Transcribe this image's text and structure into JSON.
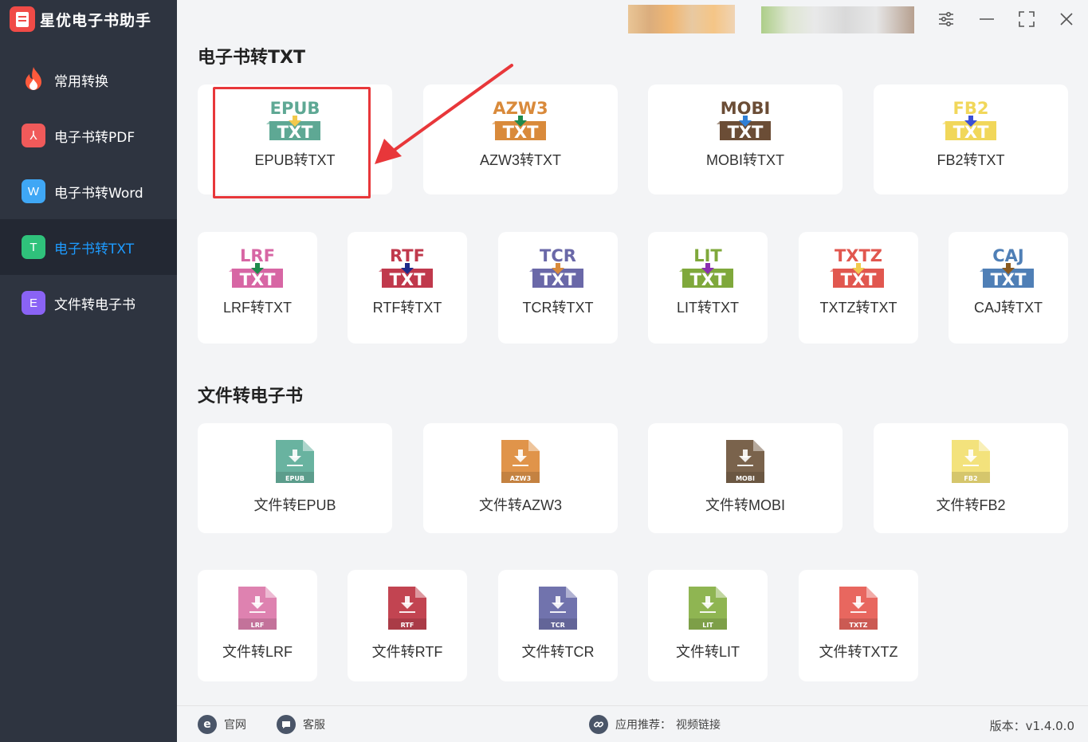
{
  "app": {
    "name": "星优电子书助手"
  },
  "sidebar": {
    "items": [
      {
        "label": "常用转换",
        "icon": "flame-icon",
        "color": "#ff5a3c",
        "glyph": ""
      },
      {
        "label": "电子书转PDF",
        "icon": "pdf-icon",
        "color": "#f05a5a",
        "glyph": "⅄"
      },
      {
        "label": "电子书转Word",
        "icon": "word-icon",
        "color": "#3fa7f5",
        "glyph": "W"
      },
      {
        "label": "电子书转TXT",
        "icon": "txt-icon",
        "color": "#2fc27b",
        "glyph": "T",
        "active": true
      },
      {
        "label": "文件转电子书",
        "icon": "ebook-icon",
        "color": "#8a63f5",
        "glyph": "E"
      }
    ]
  },
  "sections": [
    {
      "title": "电子书转TXT"
    },
    {
      "title": "文件转电子书"
    }
  ],
  "to_txt": [
    {
      "fmt": "EPUB",
      "label": "EPUB转TXT",
      "color": "#5ea894",
      "arrow": "#f2c94c",
      "highlighted": true
    },
    {
      "fmt": "AZW3",
      "label": "AZW3转TXT",
      "color": "#d98a3b",
      "arrow": "#1f8a4c"
    },
    {
      "fmt": "MOBI",
      "label": "MOBI转TXT",
      "color": "#6b4d36",
      "arrow": "#2f7fd6"
    },
    {
      "fmt": "FB2",
      "label": "FB2转TXT",
      "color": "#f1d75a",
      "arrow": "#3b4fd6"
    },
    {
      "fmt": "LRF",
      "label": "LRF转TXT",
      "color": "#d766a4",
      "arrow": "#1f8a4c"
    },
    {
      "fmt": "RTF",
      "label": "RTF转TXT",
      "color": "#c0394c",
      "arrow": "#1d2a8a"
    },
    {
      "fmt": "TCR",
      "label": "TCR转TXT",
      "color": "#6a68a8",
      "arrow": "#d98a3b"
    },
    {
      "fmt": "LIT",
      "label": "LIT转TXT",
      "color": "#7fa83b",
      "arrow": "#8a2fb0"
    },
    {
      "fmt": "TXTZ",
      "label": "TXTZ转TXT",
      "color": "#e1574f",
      "arrow": "#f2c94c"
    },
    {
      "fmt": "CAJ",
      "label": "CAJ转TXT",
      "color": "#4f7fb6",
      "arrow": "#8a5a1f"
    }
  ],
  "to_ebook": [
    {
      "fmt": "EPUB",
      "label": "文件转EPUB",
      "color": "#69b3a0"
    },
    {
      "fmt": "AZW3",
      "label": "文件转AZW3",
      "color": "#e0944a"
    },
    {
      "fmt": "MOBI",
      "label": "文件转MOBI",
      "color": "#7a634c"
    },
    {
      "fmt": "FB2",
      "label": "文件转FB2",
      "color": "#f3e27c"
    },
    {
      "fmt": "LRF",
      "label": "文件转LRF",
      "color": "#de82b0"
    },
    {
      "fmt": "RTF",
      "label": "文件转RTF",
      "color": "#c24451"
    },
    {
      "fmt": "TCR",
      "label": "文件转TCR",
      "color": "#7173ad"
    },
    {
      "fmt": "LIT",
      "label": "文件转LIT",
      "color": "#8fb552"
    },
    {
      "fmt": "TXTZ",
      "label": "文件转TXTZ",
      "color": "#e8675f"
    }
  ],
  "footer": {
    "website": "官网",
    "support": "客服",
    "recommend": "应用推荐：",
    "video": "视频链接",
    "version": "版本：v1.4.0.0"
  },
  "colors": {
    "sidebar_bg": "#2e3440",
    "active_text": "#1e9bff",
    "highlight": "#e8373a"
  }
}
